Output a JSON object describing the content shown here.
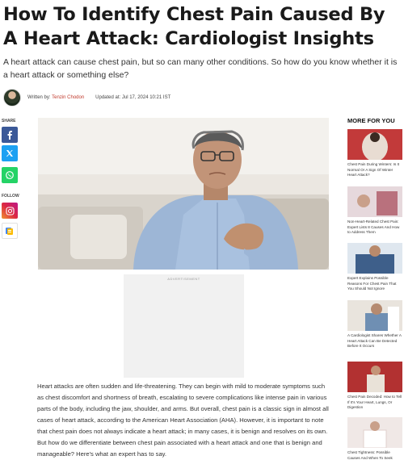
{
  "article": {
    "title": "How To Identify Chest Pain Caused By A Heart Attack: Cardiologist Insights",
    "subtitle": "A heart attack can cause chest pain, but so can many other conditions. So how do you know whether it is a heart attack or something else?",
    "byline_prefix": "Written by:",
    "author": "Tenzin Chodon",
    "updated_label": "Updated at: Jul 17, 2024 10:21 IST",
    "ad_label": "ADVERTISEMENT",
    "body": "Heart attacks are often sudden and life-threatening. They can begin with mild to moderate symptoms such as chest discomfort and shortness of breath, escalating to severe complications like intense pain in various parts of the body, including the jaw, shoulder, and arms. But overall, chest pain is a classic sign in almost all cases of heart attack, according to the American Heart Association (AHA). However, it is important to note that chest pain does not always indicate a heart attack; in many cases, it is benign and resolves on its own. But how do we differentiate between chest pain associated with a heart attack and one that is benign and manageable? Here's what an expert has to say."
  },
  "social": {
    "share_label": "SHARE",
    "follow_label": "FOLLOW",
    "icons": [
      "facebook-icon",
      "x-icon",
      "whatsapp-icon",
      "instagram-icon",
      "google-news-icon"
    ],
    "colors": {
      "facebook": "#3b5998",
      "x": "#1da1f2",
      "whatsapp": "#25d366",
      "instagram": "#c13584",
      "google_news": "#4285f4"
    }
  },
  "sidebar": {
    "title": "MORE FOR YOU",
    "items": [
      {
        "title": "Chest Pain During Winters: Is It Normal Or A Sign Of Winter Heart Attack?"
      },
      {
        "title": "Non-Heart-Related Chest Pain: Expert Lists 8 Causes And How to Address Them"
      },
      {
        "title": "Expert Explains Possible Reasons For Chest Pain That You Should Not Ignore"
      },
      {
        "title": "A Cardiologist Shares Whether A Heart Attack Can Be Detected Before It Occurs"
      },
      {
        "title": "Chest Pain Decoded: How to Tell If It's Your Heart, Lungs, Or Digestion"
      },
      {
        "title": "Chest Tightness: Possible Causes And When To Seek"
      }
    ]
  },
  "colors": {
    "accent": "#c0392b"
  }
}
